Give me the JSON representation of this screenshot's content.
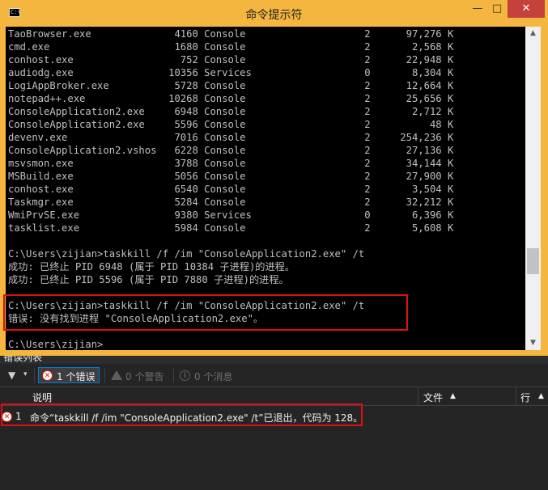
{
  "window": {
    "title": "命令提示符",
    "icon_label": "C:\\",
    "minimize": "—",
    "maximize": "□",
    "close": "✕",
    "accent_color": "#f4b63f"
  },
  "console": {
    "lines": [
      "TaoBrowser.exe              4160 Console                    2      97,276 K",
      "cmd.exe                     1680 Console                    2       2,568 K",
      "conhost.exe                  752 Console                    2      22,948 K",
      "audiodg.exe                10356 Services                   0       8,304 K",
      "LogiAppBroker.exe           5728 Console                    2      12,664 K",
      "notepad++.exe              10268 Console                    2      25,656 K",
      "ConsoleApplication2.exe     6948 Console                    2       2,712 K",
      "ConsoleApplication2.exe     5596 Console                    2          48 K",
      "devenv.exe                  7016 Console                    2     254,236 K",
      "ConsoleApplication2.vshos   6228 Console                    2      27,136 K",
      "msvsmon.exe                 3788 Console                    2      34,144 K",
      "MSBuild.exe                 5056 Console                    2      27,900 K",
      "conhost.exe                 6540 Console                    2       3,504 K",
      "Taskmgr.exe                 5284 Console                    2      32,212 K",
      "WmiPrvSE.exe                9380 Services                   0       6,396 K",
      "tasklist.exe                5984 Console                    2       5,608 K",
      "",
      "C:\\Users\\zijian>taskkill /f /im \"ConsoleApplication2.exe\" /t",
      "成功: 已终止 PID 6948 (属于 PID 10384 子进程)的进程。",
      "成功: 已终止 PID 5596 (属于 PID 7880 子进程)的进程。",
      "",
      "C:\\Users\\zijian>taskkill /f /im \"ConsoleApplication2.exe\" /t",
      "错误: 没有找到进程 \"ConsoleApplication2.exe\"。",
      "",
      "C:\\Users\\zijian>"
    ]
  },
  "error_list": {
    "panel_title": "错误列表",
    "errors_button": "1 个错误",
    "warnings_button": "0 个警告",
    "messages_button": "0 个消息",
    "columns": {
      "description": "说明",
      "file": "文件",
      "line": "行"
    },
    "rows": [
      {
        "number": "1",
        "description": "命令“taskkill /f /im \"ConsoleApplication2.exe\" /t”已退出，代码为 128。"
      }
    ]
  }
}
